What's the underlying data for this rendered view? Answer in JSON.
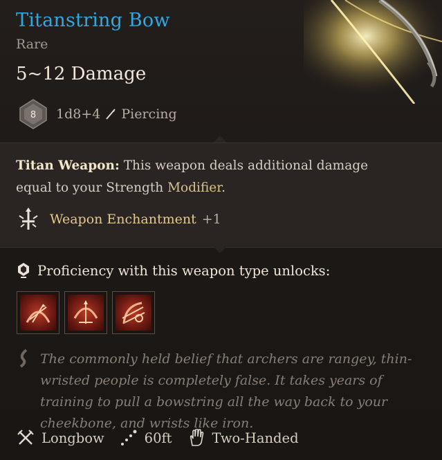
{
  "item": {
    "name": "Titanstring Bow",
    "rarity": "Rare",
    "damage": "5~12 Damage"
  },
  "dice": {
    "die_label": "8",
    "formula": "1d8+4",
    "damage_type": "Piercing"
  },
  "property": {
    "heading": "Titan Weapon:",
    "text_part1": " This weapon deals additional damage equal to your Strength ",
    "modifier_word": "Modifier",
    "text_part2": "."
  },
  "enchantment": {
    "name": "Weapon Enchantment",
    "value": "+1"
  },
  "proficiency": {
    "label": "Proficiency with this weapon type unlocks:",
    "skills": [
      {
        "icon": "skill-1-icon"
      },
      {
        "icon": "skill-2-icon"
      },
      {
        "icon": "skill-3-icon"
      }
    ]
  },
  "flavor": {
    "text": "The commonly held belief that archers are rangey, thin-wristed people is completely false. It takes years of training to pull a bowstring all the way back to your cheekbone, and wrists like iron."
  },
  "stats": {
    "weapon_type": "Longbow",
    "range": "60ft",
    "handedness": "Two-Handed"
  },
  "colors": {
    "title": "#2fa9e6",
    "enchant": "#e5c98c",
    "flavor": "#877f77",
    "panel": "#2a2523"
  }
}
